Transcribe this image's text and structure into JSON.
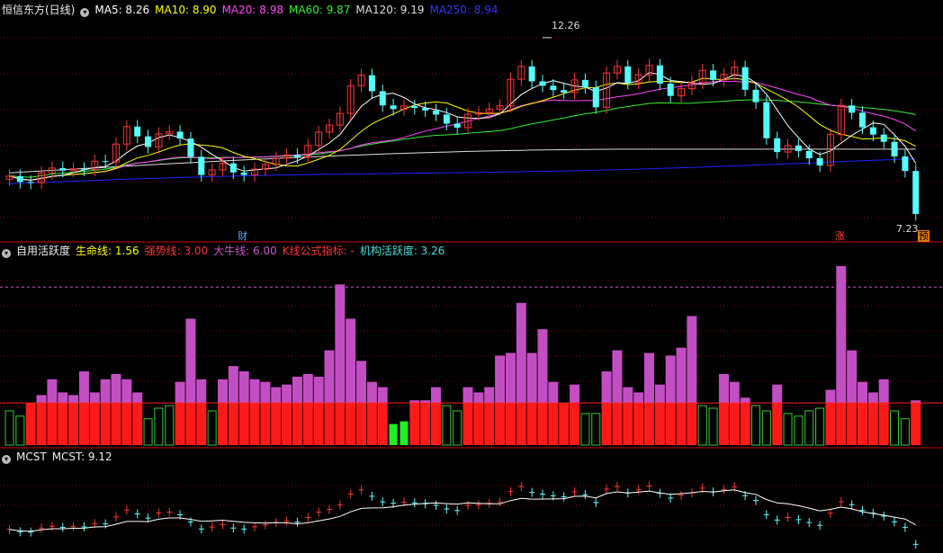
{
  "main": {
    "stock_title": "恒信东方(日线)",
    "ma_items": [
      {
        "label": "MA5: 8.26",
        "color": "#ffffff"
      },
      {
        "label": "MA10: 8.90",
        "color": "#ffff00"
      },
      {
        "label": "MA20: 8.98",
        "color": "#ff44ff"
      },
      {
        "label": "MA60: 9.87",
        "color": "#33ee33"
      },
      {
        "label": "MA120: 9.19",
        "color": "#dddddd"
      },
      {
        "label": "MA250: 8.94",
        "color": "#2222ff"
      }
    ],
    "high_label": "12.26",
    "low_label": "7.23",
    "markers": {
      "finance": "财",
      "rise": "涨",
      "forecast": "预"
    }
  },
  "indicator": {
    "name": "自用活跃度",
    "items": [
      {
        "label": "生命线: 1.56",
        "color": "#ffff00"
      },
      {
        "label": "强势线: 3.00",
        "color": "#ff3333"
      },
      {
        "label": "大牛线: 6.00",
        "color": "#cc55cc"
      },
      {
        "label": "K线公式指标: -",
        "color": "#ff3333"
      },
      {
        "label": "机构活跃度: 3.26",
        "color": "#44dddd"
      }
    ]
  },
  "mcst": {
    "name": "MCST",
    "value_label": "MCST: 9.12"
  },
  "colors": {
    "up": "#ff3333",
    "down": "#54ffff",
    "grid": "#7a0000",
    "divider": "#cc0000"
  },
  "chart_data": {
    "type": "candlestick",
    "count": 86,
    "close": [
      8.46,
      8.3,
      8.28,
      8.55,
      8.68,
      8.61,
      8.66,
      8.64,
      8.87,
      8.85,
      9.34,
      9.82,
      9.55,
      9.26,
      9.62,
      9.68,
      9.49,
      8.99,
      8.49,
      8.63,
      8.81,
      8.56,
      8.49,
      8.65,
      8.78,
      8.95,
      9.04,
      8.98,
      9.3,
      9.67,
      9.86,
      10.18,
      10.94,
      11.23,
      10.79,
      10.4,
      10.3,
      10.38,
      10.33,
      10.26,
      10.15,
      9.9,
      9.79,
      10.16,
      10.2,
      10.3,
      10.39,
      11.12,
      11.47,
      11.06,
      10.94,
      10.82,
      10.75,
      11.1,
      10.9,
      10.35,
      11.29,
      11.47,
      11.02,
      11.24,
      11.5,
      11.0,
      10.66,
      10.86,
      11.03,
      11.36,
      11.1,
      11.25,
      11.45,
      10.83,
      10.49,
      9.5,
      9.12,
      9.3,
      9.15,
      8.95,
      8.75,
      9.6,
      10.4,
      10.2,
      9.8,
      9.6,
      9.4,
      9.0,
      8.6,
      7.42
    ],
    "indicator_bars": [
      1.3,
      1.1,
      1.6,
      1.9,
      2.5,
      2.0,
      1.9,
      2.8,
      2.0,
      2.5,
      2.7,
      2.5,
      2.0,
      1.0,
      1.4,
      1.5,
      2.4,
      4.8,
      2.5,
      1.3,
      2.5,
      3.0,
      2.8,
      2.5,
      2.4,
      2.2,
      2.3,
      2.6,
      2.7,
      2.6,
      3.6,
      6.1,
      4.8,
      3.2,
      2.4,
      2.2,
      0.8,
      0.9,
      1.7,
      1.7,
      2.2,
      1.5,
      1.3,
      2.2,
      2.0,
      2.2,
      3.4,
      3.5,
      5.4,
      3.5,
      4.4,
      2.4,
      1.6,
      2.3,
      1.2,
      1.2,
      2.8,
      3.6,
      2.2,
      2.0,
      3.5,
      2.3,
      3.4,
      3.7,
      4.9,
      1.5,
      1.4,
      2.7,
      2.4,
      1.8,
      1.5,
      1.3,
      2.3,
      1.2,
      1.1,
      1.3,
      1.4,
      2.1,
      6.8,
      3.6,
      2.4,
      2.0,
      2.5,
      1.3,
      1.0,
      1.7
    ],
    "indicator_lines": {
      "生命线": 1.56,
      "强势线": 3.0,
      "大牛线": 6.0
    },
    "price_range": [
      7.0,
      12.8
    ]
  }
}
